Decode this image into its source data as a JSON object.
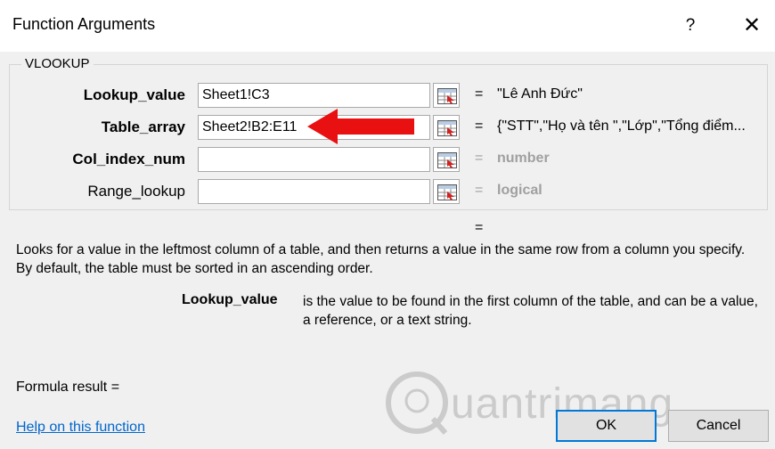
{
  "window": {
    "title": "Function Arguments",
    "help_label": "?",
    "close_label": "✕"
  },
  "function": {
    "name": "VLOOKUP",
    "args": [
      {
        "label": "Lookup_value",
        "value": "Sheet1!C3",
        "result": "\"Lê Anh Đức\"",
        "bold_label": true
      },
      {
        "label": "Table_array",
        "value": "Sheet2!B2:E11",
        "result": "{\"STT\",\"Họ và tên \",\"Lớp\",\"Tổng điểm...",
        "bold_label": true
      },
      {
        "label": "Col_index_num",
        "value": "",
        "result": "number",
        "bold_label": true
      },
      {
        "label": "Range_lookup",
        "value": "",
        "result": "logical",
        "bold_label": false
      }
    ],
    "equals": "=",
    "overall_result": "="
  },
  "description": {
    "main": "Looks for a value in the leftmost column of a table, and then returns a value in the same row from a column you specify. By default, the table must be sorted in an ascending order.",
    "arg_name": "Lookup_value",
    "arg_text": "is the value to be found in the first column of the table, and can be a value, a reference, or a text string."
  },
  "footer": {
    "formula_result": "Formula result =",
    "help_link": "Help on this function",
    "ok_label": "OK",
    "cancel_label": "Cancel"
  },
  "watermark": {
    "text": "uantrimang"
  },
  "colors": {
    "accent": "#0078d7",
    "arrow": "#e81010",
    "link": "#0066cc"
  },
  "icons": [
    "help-icon",
    "close-icon",
    "range-select-icon",
    "red-arrow-icon",
    "watermark-logo-icon"
  ]
}
